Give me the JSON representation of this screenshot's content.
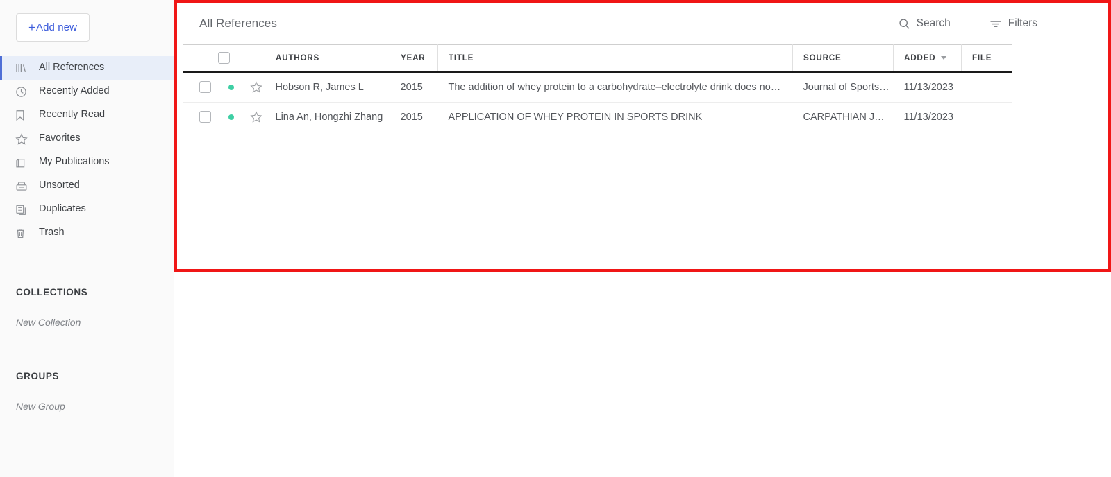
{
  "sidebar": {
    "add_new": {
      "label": "Add new",
      "plus": "+"
    },
    "items": [
      {
        "label": "All References",
        "icon": "library-icon",
        "active": true
      },
      {
        "label": "Recently Added",
        "icon": "clock-icon",
        "active": false
      },
      {
        "label": "Recently Read",
        "icon": "bookmark-icon",
        "active": false
      },
      {
        "label": "Favorites",
        "icon": "star-icon",
        "active": false
      },
      {
        "label": "My Publications",
        "icon": "publications-icon",
        "active": false
      },
      {
        "label": "Unsorted",
        "icon": "inbox-icon",
        "active": false
      },
      {
        "label": "Duplicates",
        "icon": "duplicates-icon",
        "active": false
      },
      {
        "label": "Trash",
        "icon": "trash-icon",
        "active": false
      }
    ],
    "collections": {
      "heading": "COLLECTIONS",
      "new_label": "New Collection"
    },
    "groups": {
      "heading": "GROUPS",
      "new_label": "New Group"
    }
  },
  "topbar": {
    "title": "All References",
    "search_label": "Search",
    "filters_label": "Filters"
  },
  "table": {
    "columns": [
      {
        "key": "check",
        "label": ""
      },
      {
        "key": "flags",
        "label": ""
      },
      {
        "key": "authors",
        "label": "AUTHORS"
      },
      {
        "key": "year",
        "label": "YEAR"
      },
      {
        "key": "title",
        "label": "TITLE"
      },
      {
        "key": "source",
        "label": "SOURCE"
      },
      {
        "key": "added",
        "label": "ADDED",
        "sorted": true,
        "sort_dir": "desc"
      },
      {
        "key": "file",
        "label": "FILE"
      }
    ],
    "rows": [
      {
        "checked": false,
        "unread_dot": true,
        "favorite": false,
        "authors": "Hobson R, James L",
        "year": "2015",
        "title": "The addition of whey protein to a carbohydrate–electrolyte drink does no…",
        "source": "Journal of Sports…",
        "added": "11/13/2023",
        "file": ""
      },
      {
        "checked": false,
        "unread_dot": true,
        "favorite": false,
        "authors": "Lina An, Hongzhi Zhang",
        "year": "2015",
        "title": "APPLICATION OF WHEY PROTEIN IN SPORTS DRINK",
        "source": "CARPATHIAN J…",
        "added": "11/13/2023",
        "file": ""
      }
    ]
  },
  "colors": {
    "accent_blue": "#3b5bdb",
    "active_item_bg": "#e8eef9",
    "active_item_bar": "#4f6fd6",
    "unread_dot": "#3ecfa4",
    "highlight_box": "#f01616",
    "sidebar_bg": "#fafafa"
  }
}
